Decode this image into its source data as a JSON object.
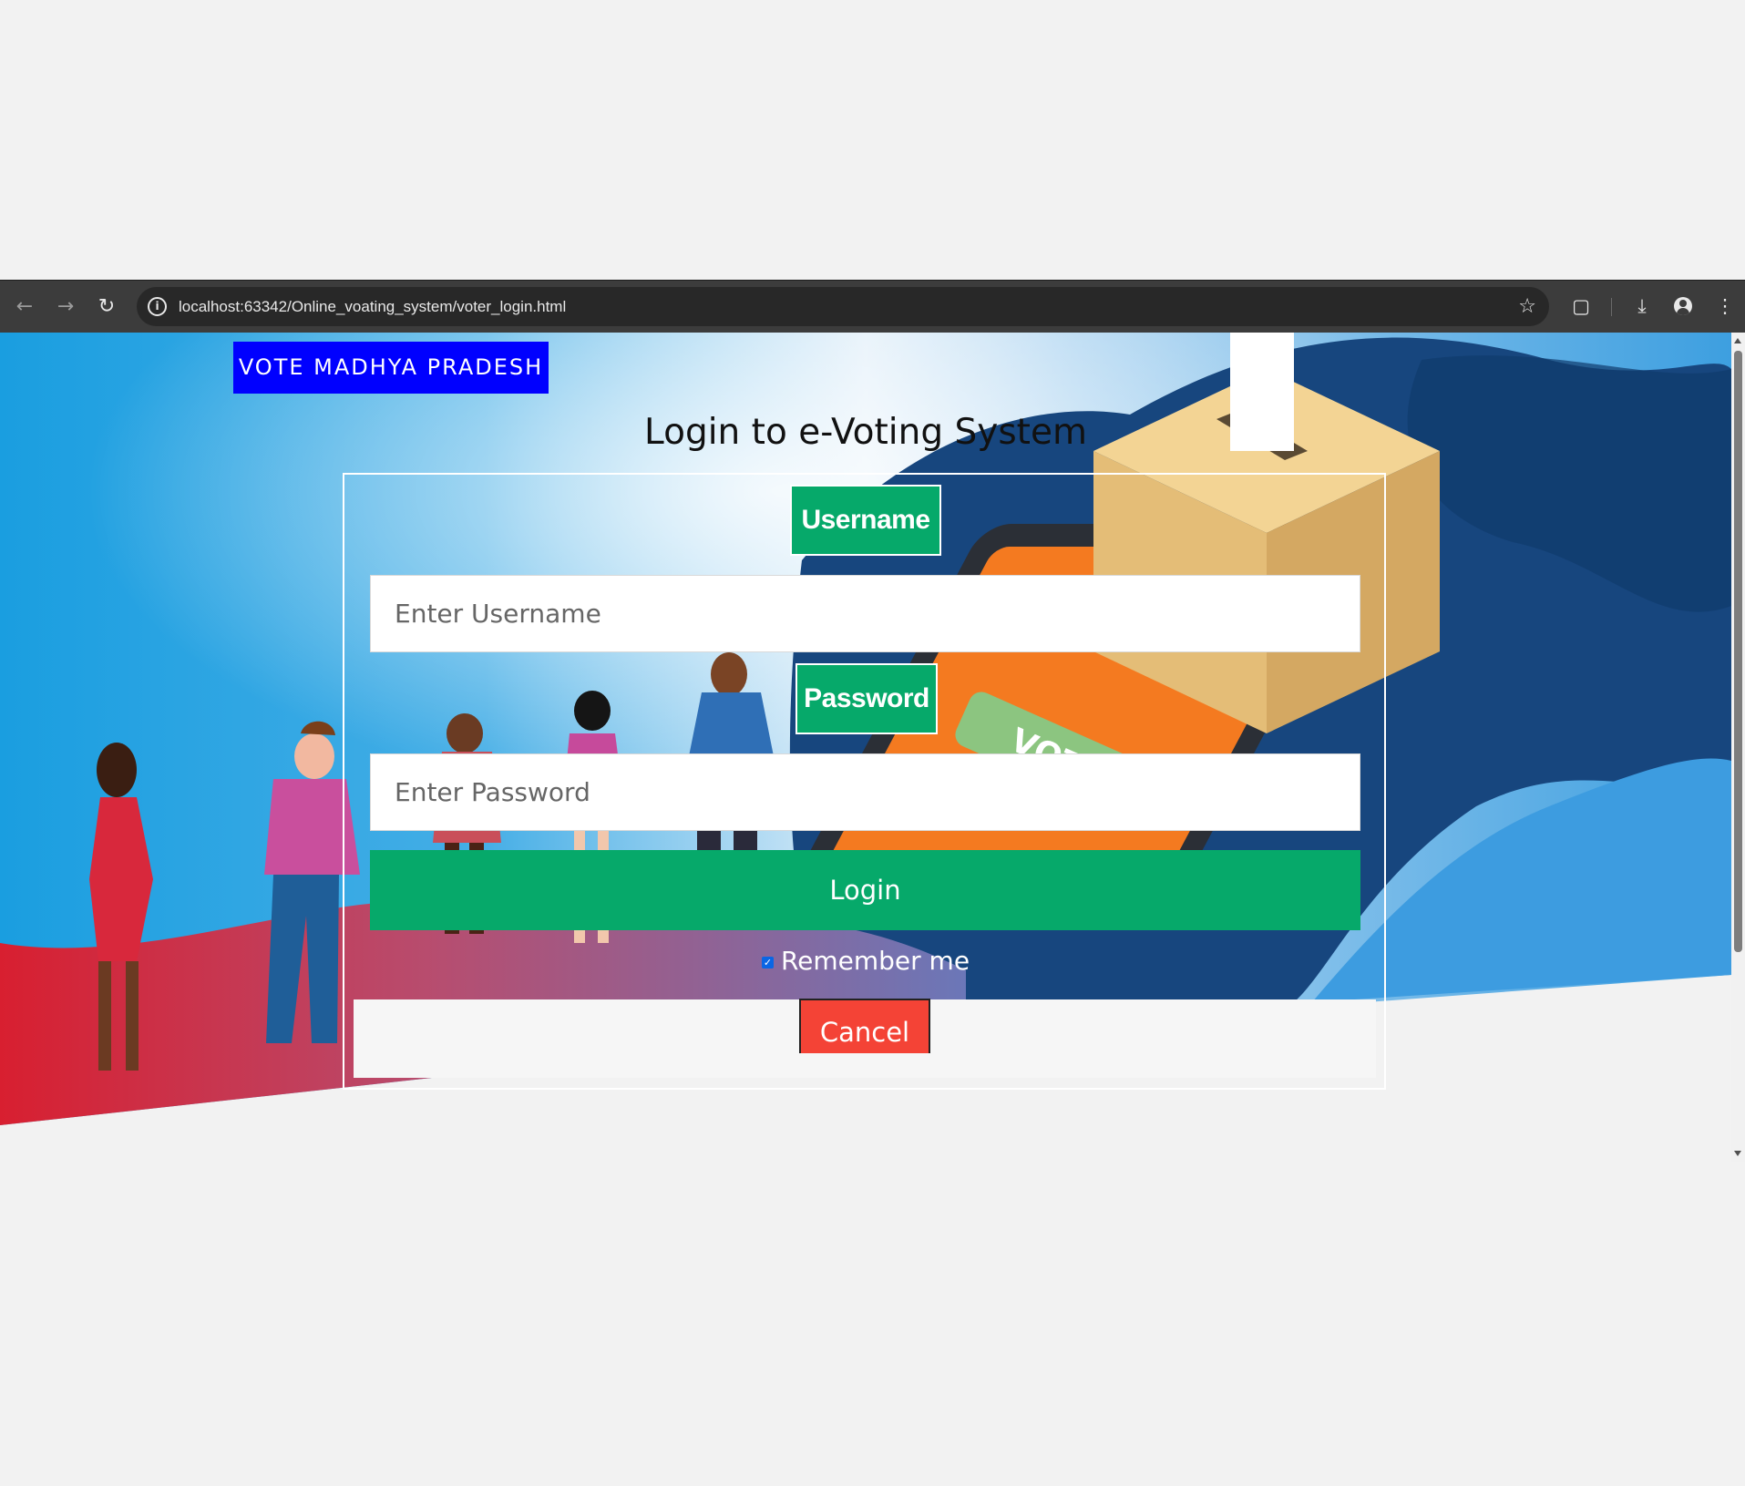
{
  "browser": {
    "url": "localhost:63342/Online_voating_system/voter_login.html",
    "icons": [
      "back-icon",
      "forward-icon",
      "reload-icon",
      "site-info-icon",
      "bookmark-star-icon",
      "extensions-icon",
      "download-icon",
      "profile-icon",
      "menu-dots-icon"
    ]
  },
  "page": {
    "brand": "VOTE MADHYA PRADESH",
    "title": "Login to e-Voting System",
    "username_label": "Username",
    "username_placeholder": "Enter Username",
    "username_value": "",
    "password_label": "Password",
    "password_placeholder": "Enter Password",
    "password_value": "",
    "login_label": "Login",
    "remember_label": "Remember me",
    "remember_checked": true,
    "cancel_label": "Cancel",
    "illustration_text": "VOTE"
  },
  "colors": {
    "brand_bg": "#0000ff",
    "accent_green": "#06a96a",
    "cancel_red": "#f44336",
    "chrome_bg": "#3c3c3c"
  }
}
